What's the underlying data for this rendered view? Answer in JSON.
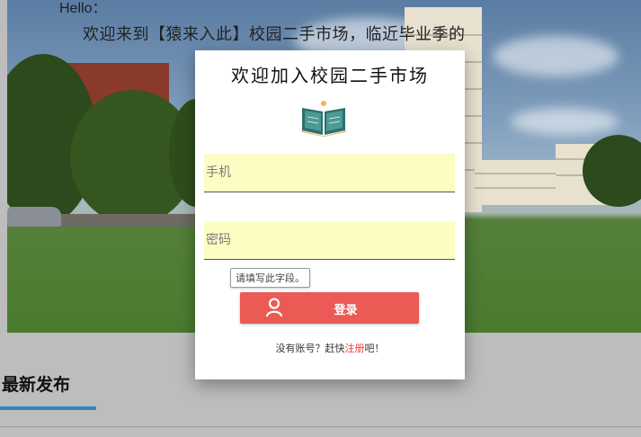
{
  "page": {
    "hello": "Hello：",
    "welcome": "欢迎来到【猿来入此】校园二手市场，临近毕业季的",
    "section_title": "最新发布"
  },
  "login_modal": {
    "title": "欢迎加入校园二手市场",
    "icon": "book-icon",
    "phone_placeholder": "手机",
    "password_placeholder": "密码",
    "validation_tooltip": "请填写此字段。",
    "login_button": "登录",
    "login_icon": "user-icon",
    "register_prefix": "没有账号？赶快",
    "register_link": "注册",
    "register_suffix": "吧！"
  },
  "colors": {
    "accent_button": "#eb5a55",
    "field_background": "#fbfdc3",
    "section_underline": "#2b85c4",
    "link": "#e0443e"
  }
}
